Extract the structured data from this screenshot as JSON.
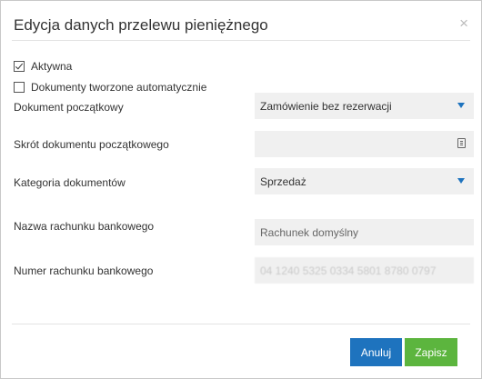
{
  "dialog": {
    "title": "Edycja danych przelewu pieniężnego",
    "close_label": "×"
  },
  "checkboxes": {
    "active": {
      "label": "Aktywna",
      "checked": true
    },
    "auto_docs": {
      "label": "Dokumenty tworzone automatycznie",
      "checked": false
    }
  },
  "fields": {
    "initial_document": {
      "label": "Dokument początkowy",
      "value": "Zamówienie bez rezerwacji"
    },
    "initial_document_short": {
      "label": "Skrót dokumentu początkowego",
      "value": ""
    },
    "document_category": {
      "label": "Kategoria dokumentów",
      "value": "Sprzedaż"
    },
    "bank_account_name": {
      "label": "Nazwa rachunku bankowego",
      "value": "Rachunek domyślny"
    },
    "bank_account_number": {
      "label": "Numer rachunku bankowego",
      "value": "04 1240 5325 0334 5801 8780 0797"
    }
  },
  "buttons": {
    "cancel": "Anuluj",
    "save": "Zapisz"
  },
  "colors": {
    "primary": "#1e73be",
    "success": "#5cb53e",
    "field_bg": "#f0f0f0"
  }
}
